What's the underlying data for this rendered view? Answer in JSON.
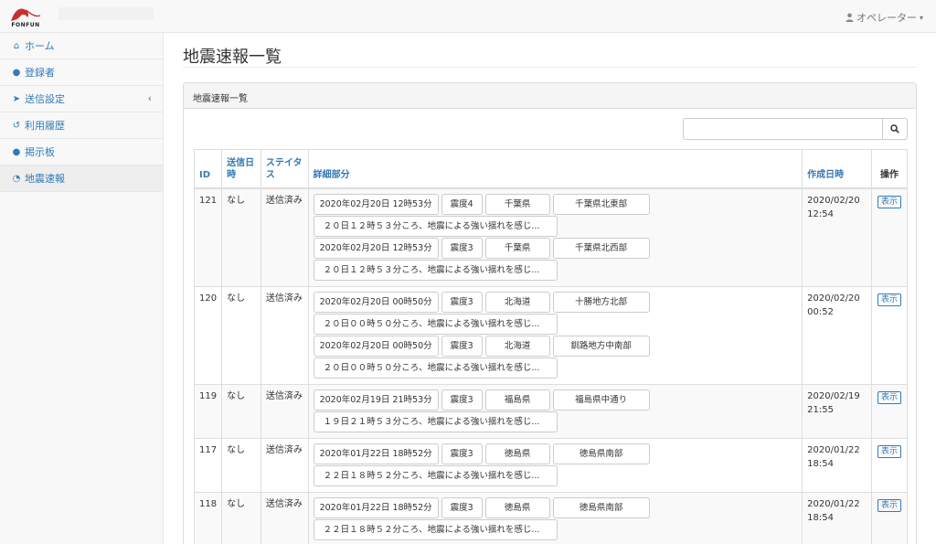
{
  "header": {
    "logo_text": "FONFUN",
    "user_label": "オペレーター",
    "caret": "▾"
  },
  "sidebar": {
    "items": [
      {
        "icon": "home-icon",
        "glyph": "⌂",
        "label": "ホーム"
      },
      {
        "icon": "user-icon",
        "glyph": "●",
        "label": "登録者"
      },
      {
        "icon": "paper-plane-icon",
        "glyph": "➤",
        "label": "送信設定",
        "chevron": "‹"
      },
      {
        "icon": "history-icon",
        "glyph": "↺",
        "label": "利用履歴"
      },
      {
        "icon": "comments-icon",
        "glyph": "●",
        "label": "掲示板"
      },
      {
        "icon": "rss-icon",
        "glyph": "◔",
        "label": "地震速報"
      }
    ],
    "active_index": 5
  },
  "page": {
    "title": "地震速報一覧",
    "panel_title": "地震速報一覧"
  },
  "search": {
    "value": "",
    "button_icon": "search-icon"
  },
  "table": {
    "headers": {
      "id": "ID",
      "send_date": "送信日時",
      "status": "ステイタス",
      "detail": "詳細部分",
      "created": "作成日時",
      "ops": "操作"
    },
    "show_label": "表示",
    "rows": [
      {
        "id": "121",
        "send_date": "なし",
        "status": "送信済み",
        "created_date": "2020/02/20",
        "created_time": "12:54",
        "details": [
          {
            "datetime": "2020年02月20日 12時53分",
            "scale": "震度4",
            "pref": "千葉県",
            "area": "千葉県北東部",
            "message": "２０日１２時５３分ころ、地震による強い揺れを感じ..."
          },
          {
            "datetime": "2020年02月20日 12時53分",
            "scale": "震度3",
            "pref": "千葉県",
            "area": "千葉県北西部",
            "message": "２０日１２時５３分ころ、地震による強い揺れを感じ..."
          }
        ]
      },
      {
        "id": "120",
        "send_date": "なし",
        "status": "送信済み",
        "created_date": "2020/02/20",
        "created_time": "00:52",
        "details": [
          {
            "datetime": "2020年02月20日 00時50分",
            "scale": "震度3",
            "pref": "北海道",
            "area": "十勝地方北部",
            "message": "２０日００時５０分ころ、地震による強い揺れを感じ..."
          },
          {
            "datetime": "2020年02月20日 00時50分",
            "scale": "震度3",
            "pref": "北海道",
            "area": "釧路地方中南部",
            "message": "２０日００時５０分ころ、地震による強い揺れを感じ..."
          }
        ]
      },
      {
        "id": "119",
        "send_date": "なし",
        "status": "送信済み",
        "created_date": "2020/02/19",
        "created_time": "21:55",
        "details": [
          {
            "datetime": "2020年02月19日 21時53分",
            "scale": "震度3",
            "pref": "福島県",
            "area": "福島県中通り",
            "message": "１９日２１時５３分ころ、地震による強い揺れを感じ..."
          }
        ]
      },
      {
        "id": "117",
        "send_date": "なし",
        "status": "送信済み",
        "created_date": "2020/01/22",
        "created_time": "18:54",
        "details": [
          {
            "datetime": "2020年01月22日 18時52分",
            "scale": "震度3",
            "pref": "徳島県",
            "area": "徳島県南部",
            "message": "２２日１８時５２分ころ、地震による強い揺れを感じ..."
          }
        ]
      },
      {
        "id": "118",
        "send_date": "なし",
        "status": "送信済み",
        "created_date": "2020/01/22",
        "created_time": "18:54",
        "details": [
          {
            "datetime": "2020年01月22日 18時52分",
            "scale": "震度3",
            "pref": "徳島県",
            "area": "徳島県南部",
            "message": "２２日１８時５２分ころ、地震による強い揺れを感じ..."
          }
        ]
      }
    ]
  },
  "colors": {
    "link": "#337ab7",
    "border": "#dddddd",
    "sidebar_bg": "#f8f8f8",
    "logo_red": "#c9302c"
  }
}
